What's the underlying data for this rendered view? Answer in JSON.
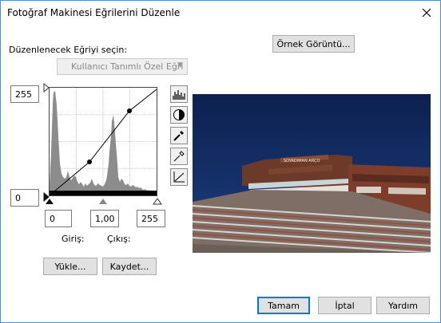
{
  "window": {
    "title": "Fotoğraf Makinesi Eğrilerini Düzenle"
  },
  "curve_select": {
    "label": "Düzenlenecek Eğriyi seçin:",
    "value": "Kullanıcı Tanımlı Özel Eğri"
  },
  "sample_button": "Örnek Görüntü...",
  "curve_axis": {
    "top_value": "255",
    "bottom_value": "0"
  },
  "inputs": {
    "input_min": "0",
    "gamma": "1,00",
    "input_max": "255"
  },
  "labels": {
    "input": "Giriş:",
    "output": "Çıkış:"
  },
  "buttons": {
    "load": "Yükle...",
    "save": "Kaydet...",
    "ok": "Tamam",
    "cancel": "İptal",
    "help": "Yardım"
  },
  "tools": [
    "histogram-icon",
    "contrast-icon",
    "black-point-eyedropper-icon",
    "white-point-eyedropper-icon",
    "curve-reset-icon"
  ],
  "preview_sign": "SOYADIMAN ARÇO",
  "colors": {
    "accent": "#0078d7",
    "sky": "#142c62",
    "histogram": "#8c8c8c"
  }
}
